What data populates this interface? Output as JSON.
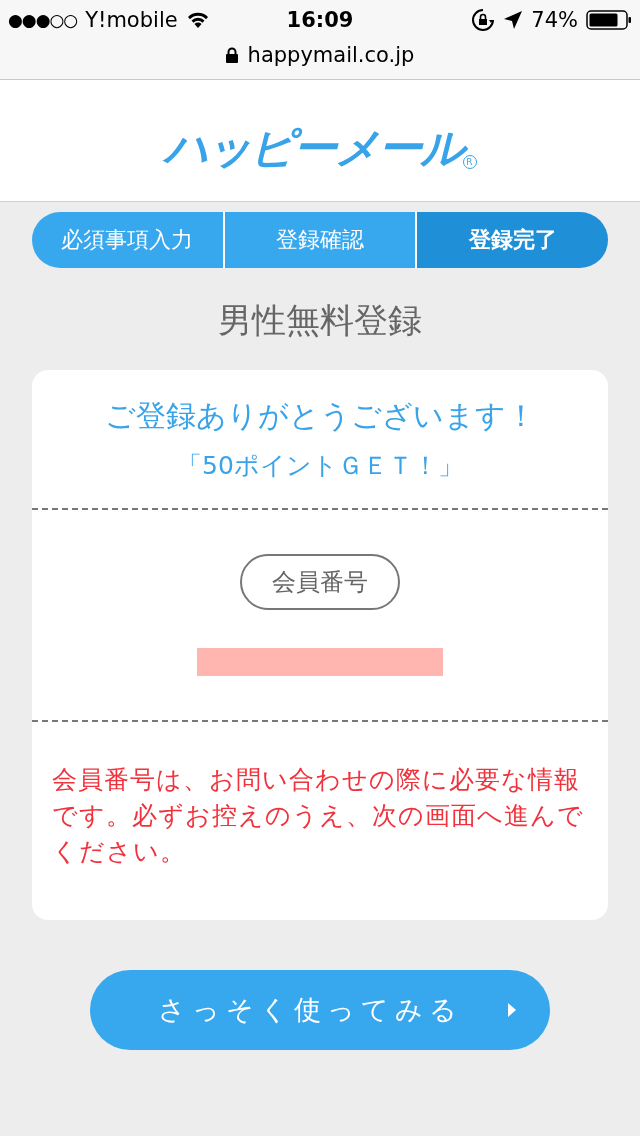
{
  "status_bar": {
    "signal": "●●●○○",
    "carrier": "Y!mobile",
    "time": "16:09",
    "battery": "74%"
  },
  "address_bar": {
    "url": "happymail.co.jp"
  },
  "header": {
    "logo": "ハッピーメール",
    "registered_mark": "R"
  },
  "steps": [
    {
      "label": "必須事項入力",
      "selected": false
    },
    {
      "label": "登録確認",
      "selected": false
    },
    {
      "label": "登録完了",
      "selected": true
    }
  ],
  "page_title": "男性無料登録",
  "card": {
    "thanks": "ご登録ありがとうございます！",
    "points": "「50ポイントＧＥＴ！」",
    "member_label": "会員番号",
    "notice": "会員番号は、お問い合わせの際に必要な情報です。必ずお控えのうえ、次の画面へ進んでください。"
  },
  "start_button": {
    "label": "さっそく使ってみる"
  }
}
